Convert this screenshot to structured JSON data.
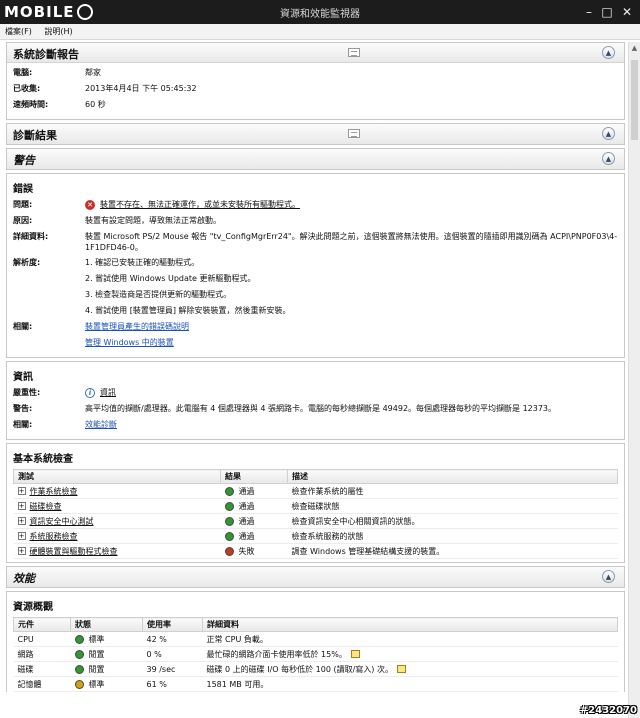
{
  "window": {
    "title": "資源和效能監視器"
  },
  "watermark": "#2432070",
  "colors": {
    "ok": "#2e9a2e",
    "fail": "#c43a1e",
    "warn": "#d4a20c",
    "link": "#1a52b8"
  },
  "menu": [
    {
      "label": "檔案(F)"
    },
    {
      "label": "說明(H)"
    }
  ],
  "report": {
    "title": "系統診斷報告",
    "fields": [
      {
        "label": "電腦:",
        "value": "鄰家"
      },
      {
        "label": "已收集:",
        "value": "2013年4月4日 下午 05:45:32"
      },
      {
        "label": "速頻時間:",
        "value": "60 秒"
      }
    ]
  },
  "diag_results": {
    "title": "診斷結果"
  },
  "warning": {
    "title": "警告"
  },
  "errors": {
    "title": "錯誤",
    "symptom_label": "問題:",
    "symptom": "裝置不存在、無法正確運作，或並未安裝所有驅動程式。",
    "cause_label": "原因:",
    "cause": "裝置有設定問題，導致無法正常啟動。",
    "details_label": "詳細資料:",
    "details": "裝置 Microsoft PS/2 Mouse 報告 \"tv_ConfigMgrErr24\"。解決此問題之前，這個裝置將無法使用。這個裝置的隨插即用識別碼為 ACPI\\PNP0F03\\4-1F1DFD46-0。",
    "resolution_label": "解析度:",
    "resolutions": [
      "1. 確認已安裝正確的驅動程式。",
      "2. 嘗試使用 Windows Update 更新驅動程式。",
      "3. 檢查製造商是否提供更新的驅動程式。",
      "4. 嘗試使用 [裝置管理員] 解除安裝裝置，然後重新安裝。"
    ],
    "related_label": "相關:",
    "related": [
      "裝置管理員產生的錯誤碼說明",
      "管理 Windows 中的裝置"
    ]
  },
  "info": {
    "title": "資訊",
    "severity_label": "嚴重性:",
    "severity": "資訊",
    "warning_label": "警告:",
    "warning": "高平均值的擷斷/處理器。此電腦有 4 個處理器與 4 張網路卡。電腦的每秒總擷斷是 49492。每個處理器每秒的平均擷斷是 12373。",
    "related_label": "相關:",
    "related": "效能診斷"
  },
  "basic_checks": {
    "title": "基本系統檢查",
    "headers": [
      "測試",
      "結果",
      "描述"
    ],
    "rows": [
      {
        "test": "作業系統檢查",
        "result": "通過",
        "status": "ok",
        "desc": "檢查作業系統的屬性"
      },
      {
        "test": "磁碟檢查",
        "result": "通過",
        "status": "ok",
        "desc": "檢查磁碟狀態"
      },
      {
        "test": "資訊安全中心測試",
        "result": "通過",
        "status": "ok",
        "desc": "檢查資訊安全中心相關資訊的狀態。"
      },
      {
        "test": "系統服務檢查",
        "result": "通過",
        "status": "ok",
        "desc": "檢查系統服務的狀態"
      },
      {
        "test": "硬體裝置與驅動程式檢查",
        "result": "失敗",
        "status": "fail",
        "desc": "調查 Windows 管理基礎結構支援的裝置。"
      }
    ]
  },
  "performance": {
    "title": "效能"
  },
  "resources": {
    "title": "資源概觀",
    "headers": [
      "元件",
      "狀態",
      "使用率",
      "詳細資料"
    ],
    "rows": [
      {
        "component": "CPU",
        "status": "標準",
        "color": "ok",
        "usage": "42 %",
        "detail": "正常 CPU 負載。",
        "edit": false
      },
      {
        "component": "網路",
        "status": "閒置",
        "color": "ok",
        "usage": "0 %",
        "detail": "最忙碌的網路介面卡使用率低於 15%。",
        "edit": true
      },
      {
        "component": "磁碟",
        "status": "閒置",
        "color": "ok",
        "usage": "39 /sec",
        "detail": "磁碟 0 上的磁碟 I/O 每秒低於 100 (讀取/寫入) 次。",
        "edit": true
      },
      {
        "component": "記憶體",
        "status": "標準",
        "color": "warn",
        "usage": "61 %",
        "detail": "1581 MB 可用。",
        "edit": false
      }
    ]
  }
}
